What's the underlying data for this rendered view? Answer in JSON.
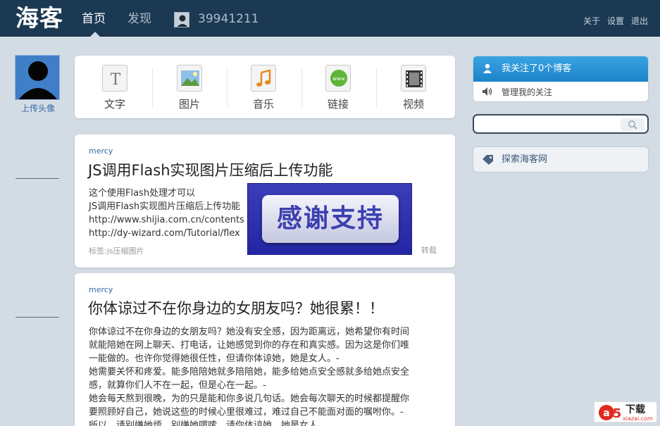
{
  "header": {
    "logo": "海客",
    "nav_home": "首页",
    "nav_discover": "发现",
    "user_id": "39941211",
    "links": [
      "关于",
      "设置",
      "退出"
    ]
  },
  "sidebar_left": {
    "upload_avatar": "上传头像"
  },
  "post_types": [
    {
      "label": "文字",
      "icon": "text-icon"
    },
    {
      "label": "图片",
      "icon": "image-icon"
    },
    {
      "label": "音乐",
      "icon": "music-icon"
    },
    {
      "label": "链接",
      "icon": "link-icon"
    },
    {
      "label": "视频",
      "icon": "video-icon"
    }
  ],
  "posts": [
    {
      "author": "mercy",
      "title": "JS调用Flash实现图片压缩后上传功能",
      "body": [
        "这个使用Flash处理才可以",
        "JS调用Flash实现图片压缩后上传功能",
        "http://www.shijia.com.cn/contents",
        "http://dy-wizard.com/Tutorial/flex"
      ],
      "tags": "标签:js压缩图片",
      "repost": "转载"
    },
    {
      "author": "mercy",
      "title": "你体谅过不在你身边的女朋友吗？她很累！！",
      "body": [
        "你体谅过不在你身边的女朋友吗？她没有安全感，因为距离远，她希望你有时间",
        "就能陪她在网上聊天、打电话，让她感觉到你的存在和真实感。因为这是你们唯",
        "一能做的。也许你觉得她很任性，但请你体谅她，她是女人。-",
        "她需要关怀和疼爱。能多陪陪她就多陪陪她，能多给她点安全感就多给她点安全",
        "感，就算你们人不在一起，但是心在一起。-",
        "她会每天熬到很晚，为的只是能和你多说几句话。她会每次聊天的时候都提醒你",
        "要照顾好自己，她说这些的时候心里很难过，难过自己不能面对面的嘱咐你。-",
        "所以，请别嫌她烦，别嫌她啰嗦，请你体谅她，她是女人。"
      ]
    }
  ],
  "overlay": {
    "text": "感谢支持"
  },
  "sidebar_right": {
    "following_title": "我关注了0个博客",
    "manage_following": "管理我的关注",
    "search_placeholder": "",
    "explore": "探索海客网"
  },
  "watermark": {
    "brand": "下载",
    "sub": "xiazai.com"
  },
  "colors": {
    "header_bg": "#1b3953",
    "page_bg": "#d3dce4",
    "accent_blue": "#2584cc",
    "link_blue": "#2e6da4"
  }
}
